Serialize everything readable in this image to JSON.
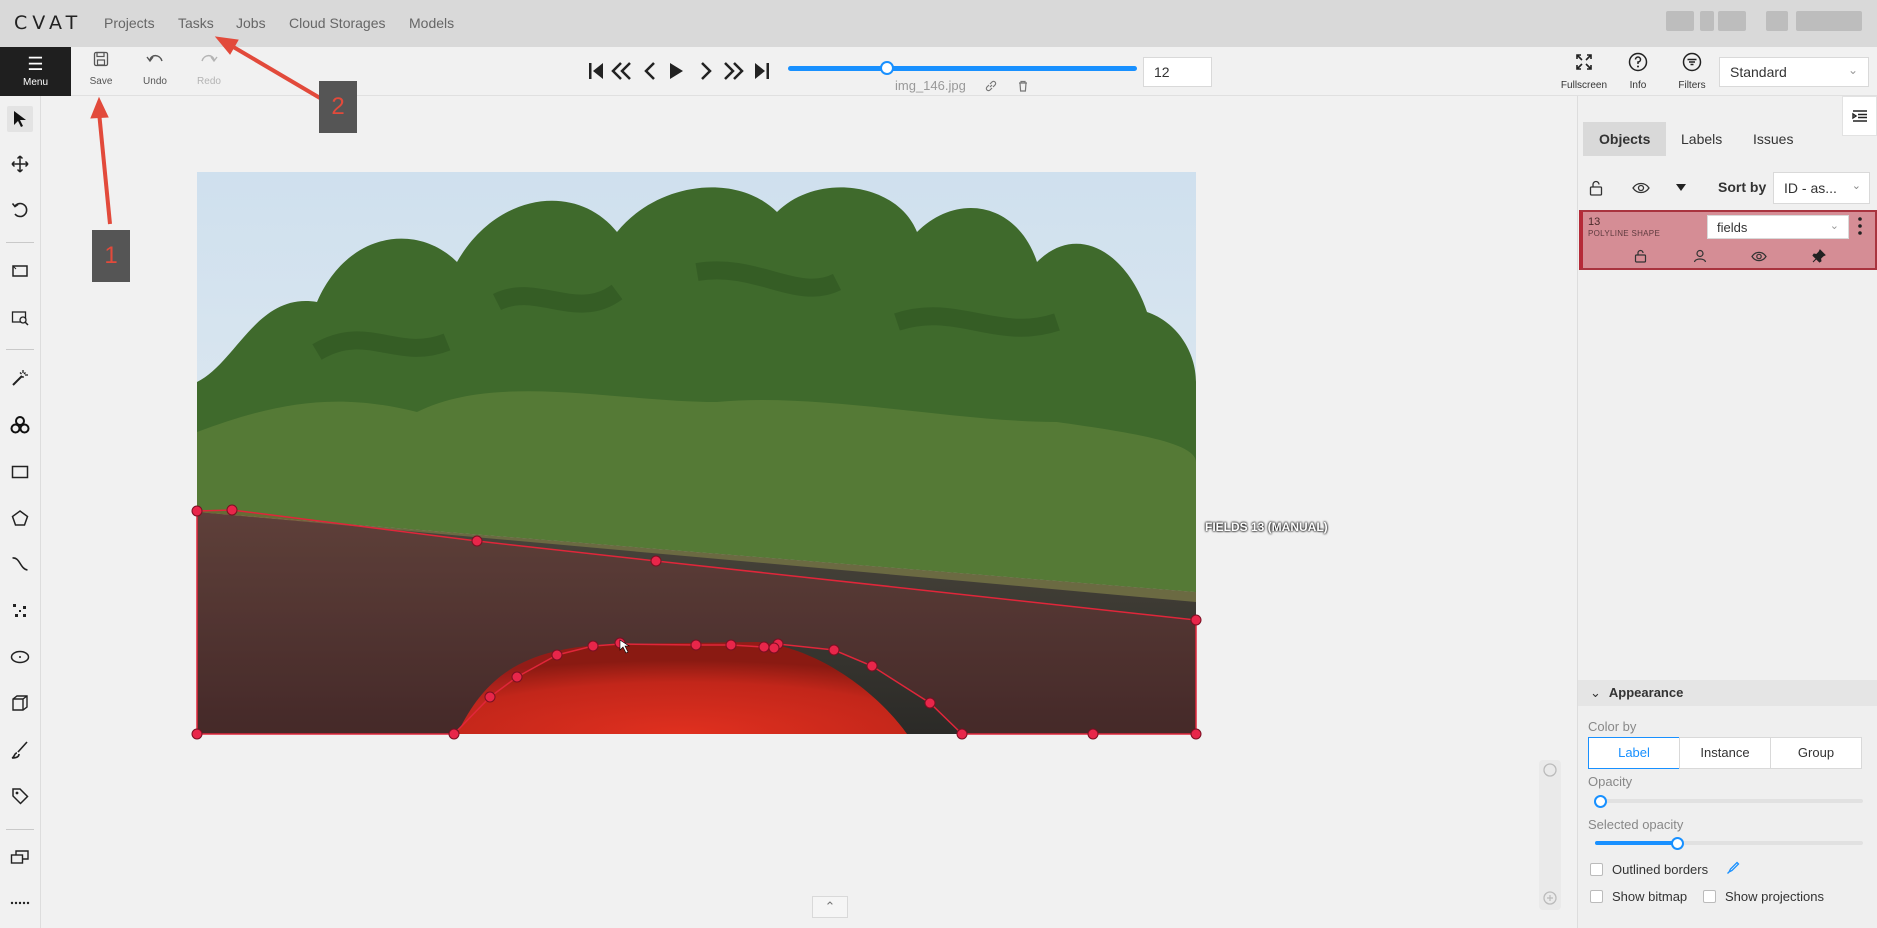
{
  "navbar": {
    "logo": "CVAT",
    "links": [
      "Projects",
      "Tasks",
      "Jobs",
      "Cloud Storages",
      "Models"
    ]
  },
  "header": {
    "menu_label": "Menu",
    "save_label": "Save",
    "undo_label": "Undo",
    "redo_label": "Redo",
    "frame_name": "img_146.jpg",
    "frame_number": "12",
    "frame_progress": 0.29,
    "fullscreen_label": "Fullscreen",
    "info_label": "Info",
    "filters_label": "Filters",
    "workspace": "Standard"
  },
  "canvas": {
    "object_label": "FIELDS 13 (MANUAL)"
  },
  "right_panel": {
    "tabs": [
      "Objects",
      "Labels",
      "Issues"
    ],
    "sort_by_label": "Sort by",
    "sort_value": "ID - as...",
    "object": {
      "id": "13",
      "type": "POLYLINE SHAPE",
      "label": "fields",
      "color": "#b52a38"
    },
    "appearance": {
      "title": "Appearance",
      "color_by_label": "Color by",
      "color_by_options": [
        "Label",
        "Instance",
        "Group"
      ],
      "color_by_selected": "Label",
      "opacity_label": "Opacity",
      "opacity_value": 0,
      "selected_opacity_label": "Selected opacity",
      "selected_opacity_value": 0.4,
      "outlined_borders_label": "Outlined borders",
      "show_bitmap_label": "Show bitmap",
      "show_projections_label": "Show projections"
    }
  },
  "annotations": {
    "callout_1": "1",
    "callout_2": "2",
    "arrow_color": "#e24a3b"
  }
}
